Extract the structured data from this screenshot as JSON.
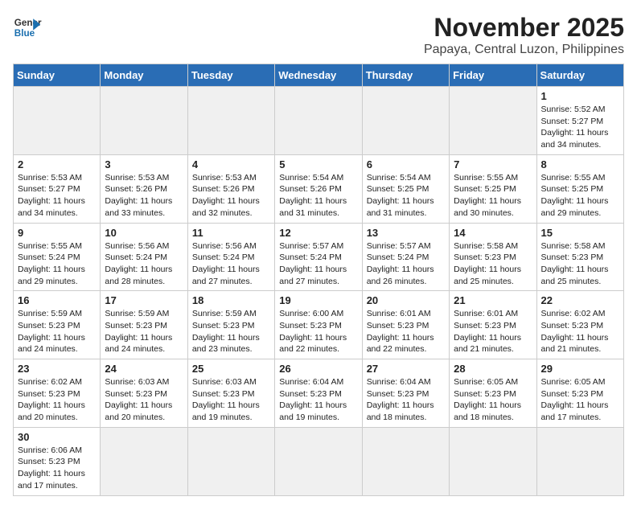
{
  "logo": {
    "general": "General",
    "blue": "Blue"
  },
  "header": {
    "month_year": "November 2025",
    "location": "Papaya, Central Luzon, Philippines"
  },
  "days_of_week": [
    "Sunday",
    "Monday",
    "Tuesday",
    "Wednesday",
    "Thursday",
    "Friday",
    "Saturday"
  ],
  "weeks": [
    [
      {
        "day": "",
        "info": ""
      },
      {
        "day": "",
        "info": ""
      },
      {
        "day": "",
        "info": ""
      },
      {
        "day": "",
        "info": ""
      },
      {
        "day": "",
        "info": ""
      },
      {
        "day": "",
        "info": ""
      },
      {
        "day": "1",
        "info": "Sunrise: 5:52 AM\nSunset: 5:27 PM\nDaylight: 11 hours\nand 34 minutes."
      }
    ],
    [
      {
        "day": "2",
        "info": "Sunrise: 5:53 AM\nSunset: 5:27 PM\nDaylight: 11 hours\nand 34 minutes."
      },
      {
        "day": "3",
        "info": "Sunrise: 5:53 AM\nSunset: 5:26 PM\nDaylight: 11 hours\nand 33 minutes."
      },
      {
        "day": "4",
        "info": "Sunrise: 5:53 AM\nSunset: 5:26 PM\nDaylight: 11 hours\nand 32 minutes."
      },
      {
        "day": "5",
        "info": "Sunrise: 5:54 AM\nSunset: 5:26 PM\nDaylight: 11 hours\nand 31 minutes."
      },
      {
        "day": "6",
        "info": "Sunrise: 5:54 AM\nSunset: 5:25 PM\nDaylight: 11 hours\nand 31 minutes."
      },
      {
        "day": "7",
        "info": "Sunrise: 5:55 AM\nSunset: 5:25 PM\nDaylight: 11 hours\nand 30 minutes."
      },
      {
        "day": "8",
        "info": "Sunrise: 5:55 AM\nSunset: 5:25 PM\nDaylight: 11 hours\nand 29 minutes."
      }
    ],
    [
      {
        "day": "9",
        "info": "Sunrise: 5:55 AM\nSunset: 5:24 PM\nDaylight: 11 hours\nand 29 minutes."
      },
      {
        "day": "10",
        "info": "Sunrise: 5:56 AM\nSunset: 5:24 PM\nDaylight: 11 hours\nand 28 minutes."
      },
      {
        "day": "11",
        "info": "Sunrise: 5:56 AM\nSunset: 5:24 PM\nDaylight: 11 hours\nand 27 minutes."
      },
      {
        "day": "12",
        "info": "Sunrise: 5:57 AM\nSunset: 5:24 PM\nDaylight: 11 hours\nand 27 minutes."
      },
      {
        "day": "13",
        "info": "Sunrise: 5:57 AM\nSunset: 5:24 PM\nDaylight: 11 hours\nand 26 minutes."
      },
      {
        "day": "14",
        "info": "Sunrise: 5:58 AM\nSunset: 5:23 PM\nDaylight: 11 hours\nand 25 minutes."
      },
      {
        "day": "15",
        "info": "Sunrise: 5:58 AM\nSunset: 5:23 PM\nDaylight: 11 hours\nand 25 minutes."
      }
    ],
    [
      {
        "day": "16",
        "info": "Sunrise: 5:59 AM\nSunset: 5:23 PM\nDaylight: 11 hours\nand 24 minutes."
      },
      {
        "day": "17",
        "info": "Sunrise: 5:59 AM\nSunset: 5:23 PM\nDaylight: 11 hours\nand 24 minutes."
      },
      {
        "day": "18",
        "info": "Sunrise: 5:59 AM\nSunset: 5:23 PM\nDaylight: 11 hours\nand 23 minutes."
      },
      {
        "day": "19",
        "info": "Sunrise: 6:00 AM\nSunset: 5:23 PM\nDaylight: 11 hours\nand 22 minutes."
      },
      {
        "day": "20",
        "info": "Sunrise: 6:01 AM\nSunset: 5:23 PM\nDaylight: 11 hours\nand 22 minutes."
      },
      {
        "day": "21",
        "info": "Sunrise: 6:01 AM\nSunset: 5:23 PM\nDaylight: 11 hours\nand 21 minutes."
      },
      {
        "day": "22",
        "info": "Sunrise: 6:02 AM\nSunset: 5:23 PM\nDaylight: 11 hours\nand 21 minutes."
      }
    ],
    [
      {
        "day": "23",
        "info": "Sunrise: 6:02 AM\nSunset: 5:23 PM\nDaylight: 11 hours\nand 20 minutes."
      },
      {
        "day": "24",
        "info": "Sunrise: 6:03 AM\nSunset: 5:23 PM\nDaylight: 11 hours\nand 20 minutes."
      },
      {
        "day": "25",
        "info": "Sunrise: 6:03 AM\nSunset: 5:23 PM\nDaylight: 11 hours\nand 19 minutes."
      },
      {
        "day": "26",
        "info": "Sunrise: 6:04 AM\nSunset: 5:23 PM\nDaylight: 11 hours\nand 19 minutes."
      },
      {
        "day": "27",
        "info": "Sunrise: 6:04 AM\nSunset: 5:23 PM\nDaylight: 11 hours\nand 18 minutes."
      },
      {
        "day": "28",
        "info": "Sunrise: 6:05 AM\nSunset: 5:23 PM\nDaylight: 11 hours\nand 18 minutes."
      },
      {
        "day": "29",
        "info": "Sunrise: 6:05 AM\nSunset: 5:23 PM\nDaylight: 11 hours\nand 17 minutes."
      }
    ],
    [
      {
        "day": "30",
        "info": "Sunrise: 6:06 AM\nSunset: 5:23 PM\nDaylight: 11 hours\nand 17 minutes."
      },
      {
        "day": "",
        "info": ""
      },
      {
        "day": "",
        "info": ""
      },
      {
        "day": "",
        "info": ""
      },
      {
        "day": "",
        "info": ""
      },
      {
        "day": "",
        "info": ""
      },
      {
        "day": "",
        "info": ""
      }
    ]
  ]
}
